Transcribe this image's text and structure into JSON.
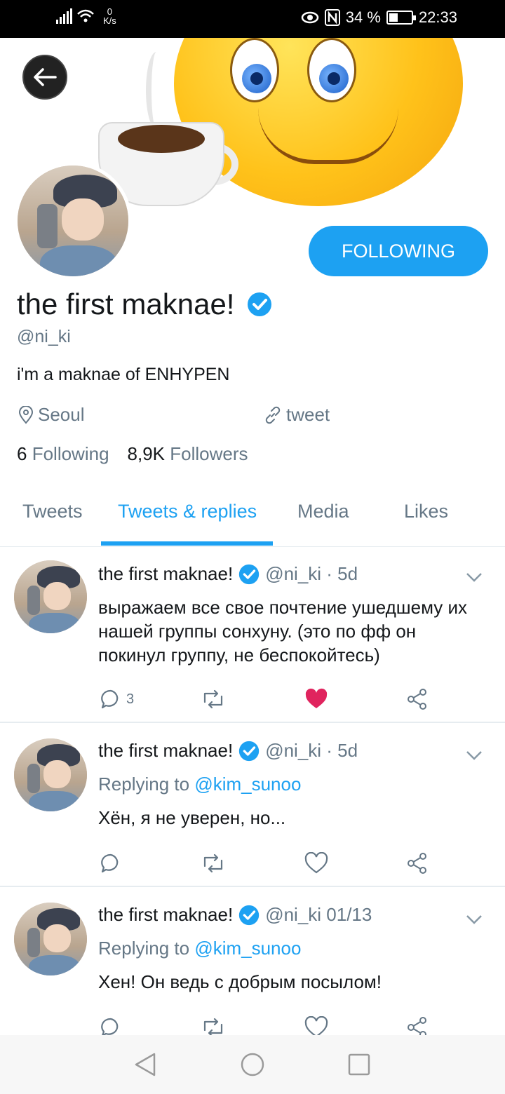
{
  "status_bar": {
    "net_speed_value": "0",
    "net_speed_unit": "K/s",
    "battery_percent": "34 %",
    "time": "22:33",
    "battery_level": 0.34
  },
  "profile": {
    "display_name": "the first maknae!",
    "handle": "@ni_ki",
    "bio": "i'm a maknae of ENHYPEN",
    "location": "Seoul",
    "link": "tweet",
    "following_count": "6",
    "following_label": "Following",
    "followers_count": "8,9K",
    "followers_label": "Followers",
    "follow_button": "FOLLOWING"
  },
  "tabs": [
    {
      "label": "Tweets"
    },
    {
      "label": "Tweets & replies"
    },
    {
      "label": "Media"
    },
    {
      "label": "Likes"
    }
  ],
  "tweets": [
    {
      "name": "the first maknae!",
      "meta": "@ni_ki · 5d",
      "text": "выражаем все свое почтение ушедшему их нашей группы сонхуну. (это по фф он покинул группу, не беспокойтесь)",
      "reply_count": "3",
      "liked": true
    },
    {
      "name": "the first maknae!",
      "meta": "@ni_ki · 5d",
      "replying_prefix": "Replying to",
      "replying_to": "@kim_sunoo",
      "text": "Хён, я не уверен, но..."
    },
    {
      "name": "the first maknae!",
      "meta": "@ni_ki 01/13",
      "replying_prefix": "Replying to",
      "replying_to": "@kim_sunoo",
      "text": "Хен! Он ведь с добрым посылом!"
    }
  ],
  "colors": {
    "accent": "#1da1f2",
    "muted": "#657786",
    "text": "#14171a",
    "like": "#e0245e"
  }
}
